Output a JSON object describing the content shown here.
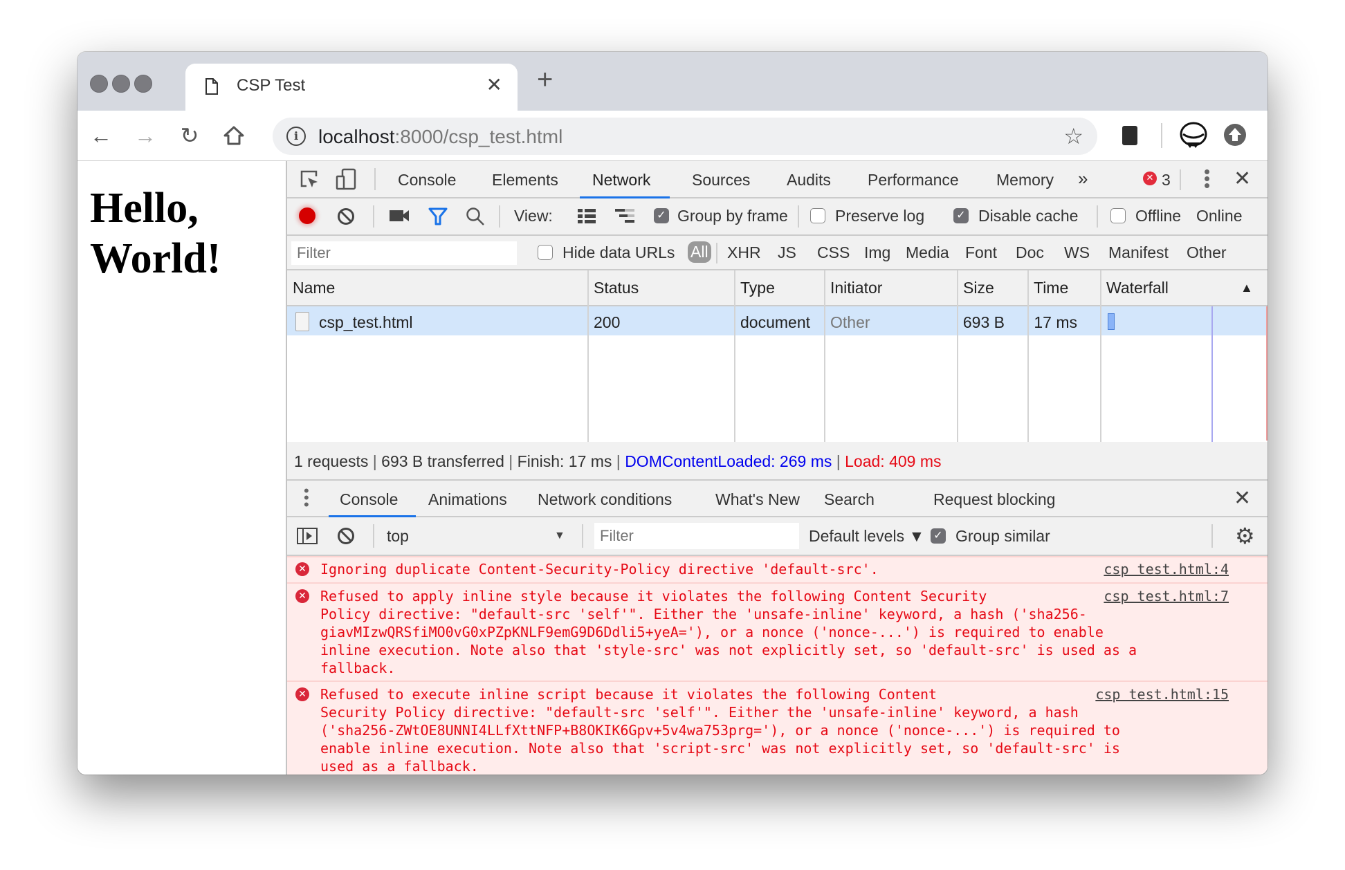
{
  "browser": {
    "tab_title": "CSP Test",
    "url_host": "localhost",
    "url_rest": ":8000/csp_test.html",
    "new_tab_icon": "plus-icon"
  },
  "page": {
    "heading_line1": "Hello,",
    "heading_line2": "World!"
  },
  "devtools": {
    "tabs": [
      "Console",
      "Elements",
      "Network",
      "Sources",
      "Audits",
      "Performance",
      "Memory"
    ],
    "active_tab": "Network",
    "more_tabs": "»",
    "error_count": "3",
    "network_toolbar": {
      "view_label": "View:",
      "group_by_frame": "Group by frame",
      "group_by_frame_checked": true,
      "preserve_log": "Preserve log",
      "preserve_log_checked": false,
      "disable_cache": "Disable cache",
      "disable_cache_checked": true,
      "offline": "Offline",
      "offline_checked": false,
      "throttling": "Online"
    },
    "filter_row": {
      "placeholder": "Filter",
      "hide_data_urls": "Hide data URLs",
      "types": [
        "All",
        "XHR",
        "JS",
        "CSS",
        "Img",
        "Media",
        "Font",
        "Doc",
        "WS",
        "Manifest",
        "Other"
      ],
      "active_type": "All"
    },
    "table": {
      "columns": [
        "Name",
        "Status",
        "Type",
        "Initiator",
        "Size",
        "Time",
        "Waterfall"
      ],
      "sort_indicator": "▲",
      "rows": [
        {
          "name": "csp_test.html",
          "status": "200",
          "type": "document",
          "initiator": "Other",
          "size": "693 B",
          "time": "17 ms"
        }
      ]
    },
    "summary": {
      "requests": "1 requests",
      "transferred": "693 B transferred",
      "finish": "Finish: 17 ms",
      "dom_content_loaded": "DOMContentLoaded: 269 ms",
      "load": "Load: 409 ms",
      "sep": " | "
    },
    "drawer": {
      "tabs": [
        "Console",
        "Animations",
        "Network conditions",
        "What's New",
        "Search",
        "Request blocking"
      ],
      "active_tab": "Console"
    },
    "console_toolbar": {
      "context": "top",
      "filter_placeholder": "Filter",
      "levels": "Default levels ▼",
      "group_similar": "Group similar",
      "group_similar_checked": true
    },
    "messages": [
      {
        "text": "Ignoring duplicate Content-Security-Policy directive 'default-src'.",
        "source": "csp test.html:4"
      },
      {
        "text": "Refused to apply inline style because it violates the following Content Security\nPolicy directive: \"default-src 'self'\". Either the 'unsafe-inline' keyword, a hash ('sha256-\ngiavMIzwQRSfiMO0vG0xPZpKNLF9emG9D6Ddli5+yeA='), or a nonce ('nonce-...') is required to enable\ninline execution. Note also that 'style-src' was not explicitly set, so 'default-src' is used as a\nfallback.",
        "source": "csp test.html:7"
      },
      {
        "text": "Refused to execute inline script because it violates the following Content\nSecurity Policy directive: \"default-src 'self'\". Either the 'unsafe-inline' keyword, a hash\n('sha256-ZWtOE8UNNI4LLfXttNFP+B8OKIK6Gpv+5v4wa753prg='), or a nonce ('nonce-...') is required to\nenable inline execution. Note also that 'script-src' was not explicitly set, so 'default-src' is\nused as a fallback.",
        "source": "csp test.html:15"
      }
    ],
    "prompt_symbol": "›"
  },
  "colors": {
    "accent": "#1a73e8",
    "error": "#e60a16",
    "dom_content_loaded": "#0000ee",
    "selected_row": "#d3e6fb",
    "error_bg": "#ffeceb"
  }
}
